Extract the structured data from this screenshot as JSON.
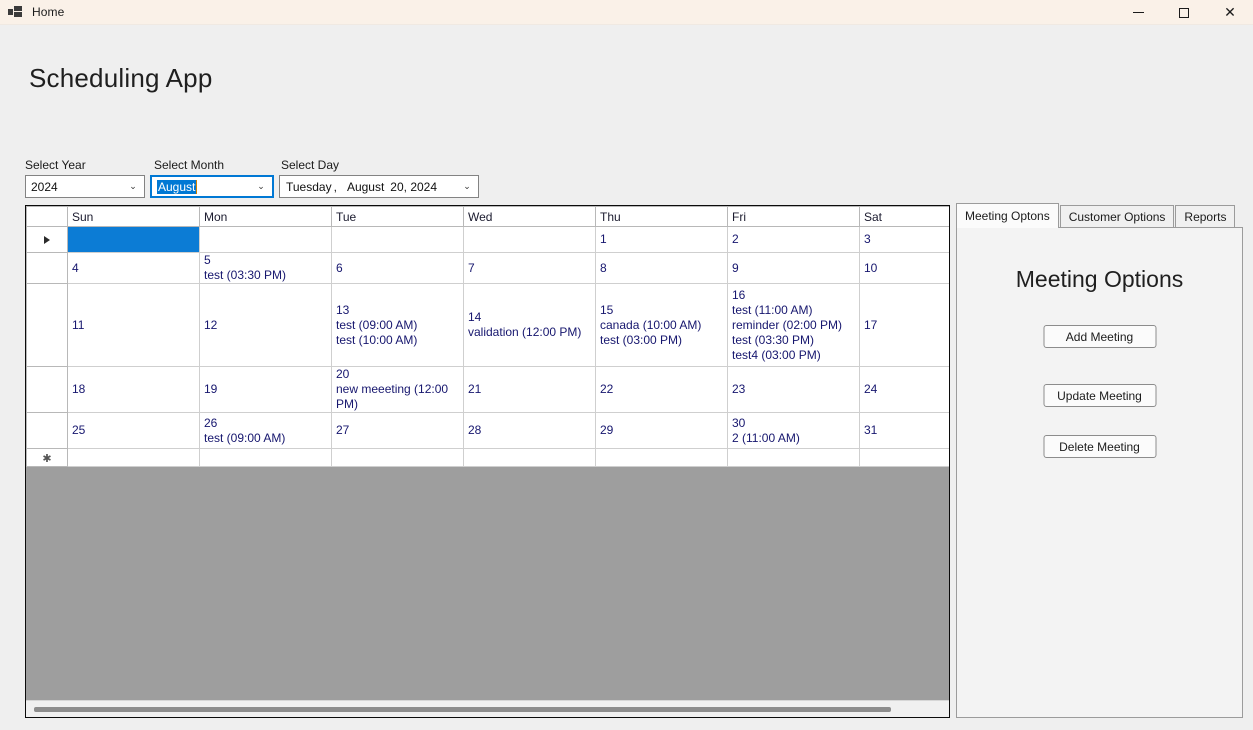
{
  "window": {
    "title": "Home",
    "icon": "app-icon",
    "minimize_label": "Minimize",
    "maximize_label": "Maximize",
    "close_label": "Close",
    "close_glyph": "✕"
  },
  "page": {
    "heading": "Scheduling App"
  },
  "selectors": {
    "year": {
      "label": "Select Year",
      "value": "2024",
      "chevron": "⌄"
    },
    "month": {
      "label": "Select Month",
      "value": "August",
      "chevron": "⌄",
      "focused": true,
      "highlight_color": "#0078d4"
    },
    "day": {
      "label": "Select Day",
      "weekday": "Tuesday",
      "comma": ",",
      "month": "August",
      "daynum": "20, 2024",
      "chevron": "⌄"
    }
  },
  "calendar": {
    "columns": [
      "",
      "Sun",
      "Mon",
      "Tue",
      "Wed",
      "Thu",
      "Fri",
      "Sat"
    ],
    "row_indicator": "current-row-arrow",
    "new_row_indicator": "✱",
    "selected_cell": {
      "row": 0,
      "col": 0,
      "color": "#0c7cd5"
    },
    "rows": [
      {
        "header": "arrow",
        "cells": [
          {
            "day": "",
            "events": [],
            "selected": true
          },
          {
            "day": "",
            "events": []
          },
          {
            "day": "",
            "events": []
          },
          {
            "day": "",
            "events": []
          },
          {
            "day": "1",
            "events": []
          },
          {
            "day": "2",
            "events": []
          },
          {
            "day": "3",
            "events": []
          }
        ]
      },
      {
        "header": "",
        "cells": [
          {
            "day": "4",
            "events": []
          },
          {
            "day": "5",
            "events": [
              "test (03:30 PM)"
            ]
          },
          {
            "day": "6",
            "events": []
          },
          {
            "day": "7",
            "events": []
          },
          {
            "day": "8",
            "events": []
          },
          {
            "day": "9",
            "events": []
          },
          {
            "day": "10",
            "events": []
          }
        ]
      },
      {
        "header": "",
        "cells": [
          {
            "day": "11",
            "events": []
          },
          {
            "day": "12",
            "events": []
          },
          {
            "day": "13",
            "events": [
              "test (09:00 AM)",
              "test (10:00 AM)"
            ]
          },
          {
            "day": "14",
            "events": [
              "validation (12:00 PM)"
            ]
          },
          {
            "day": "15",
            "events": [
              "canada (10:00 AM)",
              "test (03:00 PM)"
            ]
          },
          {
            "day": "16",
            "events": [
              "test (11:00 AM)",
              "reminder (02:00 PM)",
              "test (03:30 PM)",
              "test4 (03:00 PM)"
            ]
          },
          {
            "day": "17",
            "events": []
          }
        ]
      },
      {
        "header": "",
        "cells": [
          {
            "day": "18",
            "events": []
          },
          {
            "day": "19",
            "events": []
          },
          {
            "day": "20",
            "events": [
              "new meeeting (12:00 PM)"
            ]
          },
          {
            "day": "21",
            "events": []
          },
          {
            "day": "22",
            "events": []
          },
          {
            "day": "23",
            "events": []
          },
          {
            "day": "24",
            "events": []
          }
        ]
      },
      {
        "header": "",
        "cells": [
          {
            "day": "25",
            "events": []
          },
          {
            "day": "26",
            "events": [
              "test (09:00 AM)"
            ]
          },
          {
            "day": "27",
            "events": []
          },
          {
            "day": "28",
            "events": []
          },
          {
            "day": "29",
            "events": []
          },
          {
            "day": "30",
            "events": [
              "2 (11:00 AM)"
            ]
          },
          {
            "day": "31",
            "events": []
          }
        ]
      },
      {
        "header": "star",
        "cells": [
          {
            "day": "",
            "events": []
          },
          {
            "day": "",
            "events": []
          },
          {
            "day": "",
            "events": []
          },
          {
            "day": "",
            "events": []
          },
          {
            "day": "",
            "events": []
          },
          {
            "day": "",
            "events": []
          },
          {
            "day": "",
            "events": []
          }
        ]
      }
    ]
  },
  "scrollbar": {
    "orientation": "horizontal",
    "thumb_name": "horizontal-scroll-thumb"
  },
  "tabs": [
    {
      "label": "Meeting Optons",
      "active": true
    },
    {
      "label": "Customer Options",
      "active": false
    },
    {
      "label": "Reports",
      "active": false
    }
  ],
  "meeting_panel": {
    "heading": "Meeting Options",
    "add_label": "Add Meeting",
    "update_label": "Update Meeting",
    "delete_label": "Delete Meeting"
  }
}
